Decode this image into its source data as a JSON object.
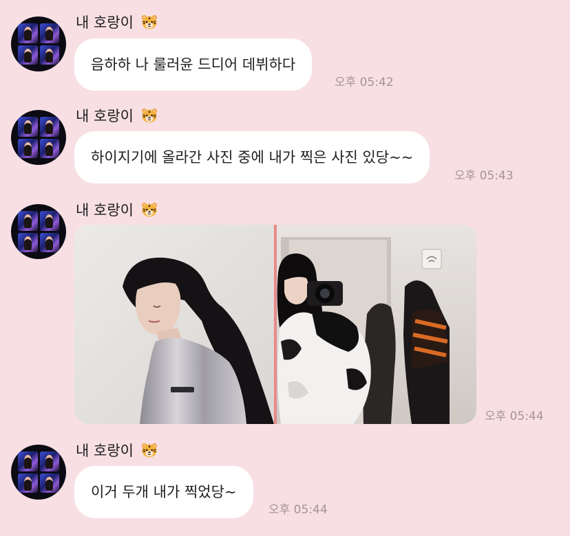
{
  "messages": [
    {
      "sender": "내 호랑이",
      "text": "음하하 나 룰러윤 드디어 데뷔하다",
      "time": "오후 05:42"
    },
    {
      "sender": "내 호랑이",
      "text": "하이지기에 올라간 사진 중에 내가 찍은 사진 있당~~",
      "time": "오후 05:43"
    },
    {
      "sender": "내 호랑이",
      "image_photos": 2,
      "time": "오후 05:44"
    },
    {
      "sender": "내 호랑이",
      "text": "이거 두개 내가 찍었당~",
      "time": "오후 05:44"
    }
  ],
  "icons": {
    "avatar": "profile-photo",
    "sender_emoji": "tiger-face-emoji"
  },
  "colors": {
    "background": "#f7dfe3",
    "bubble": "#ffffff",
    "time_text": "#a59498"
  }
}
